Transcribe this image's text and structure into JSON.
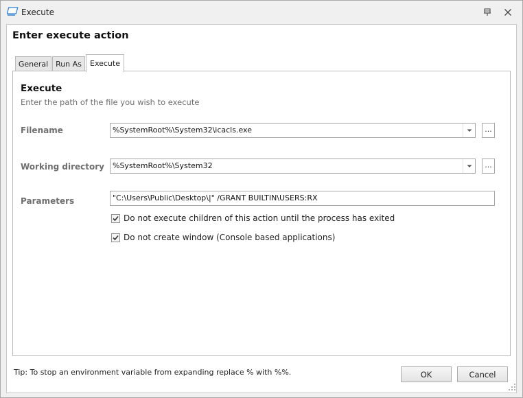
{
  "window": {
    "title": "Execute"
  },
  "dialog": {
    "title": "Enter execute action",
    "tabs": [
      {
        "label": "General"
      },
      {
        "label": "Run As"
      },
      {
        "label": "Execute",
        "selected": true
      }
    ]
  },
  "section": {
    "title": "Execute",
    "subtitle": "Enter the path of the file you wish to execute"
  },
  "fields": {
    "filename": {
      "label": "Filename",
      "value": "%SystemRoot%\\System32\\icacls.exe"
    },
    "working_directory": {
      "label": "Working directory",
      "value": "%SystemRoot%\\System32"
    },
    "parameters": {
      "label": "Parameters",
      "value": "\"C:\\Users\\Public\\Desktop\\|\" /GRANT BUILTIN\\USERS:RX"
    }
  },
  "options": [
    {
      "label": "Do not execute children of this action until the process has exited",
      "checked": true
    },
    {
      "label": "Do not create window (Console based applications)",
      "checked": true
    }
  ],
  "tip": "Tip: To stop an environment variable from expanding replace % with %%.",
  "buttons": {
    "ok": "OK",
    "cancel": "Cancel",
    "browse": "..."
  },
  "colors": {
    "accent": "#1f7fd6",
    "label_gray": "#6f6f6f"
  }
}
